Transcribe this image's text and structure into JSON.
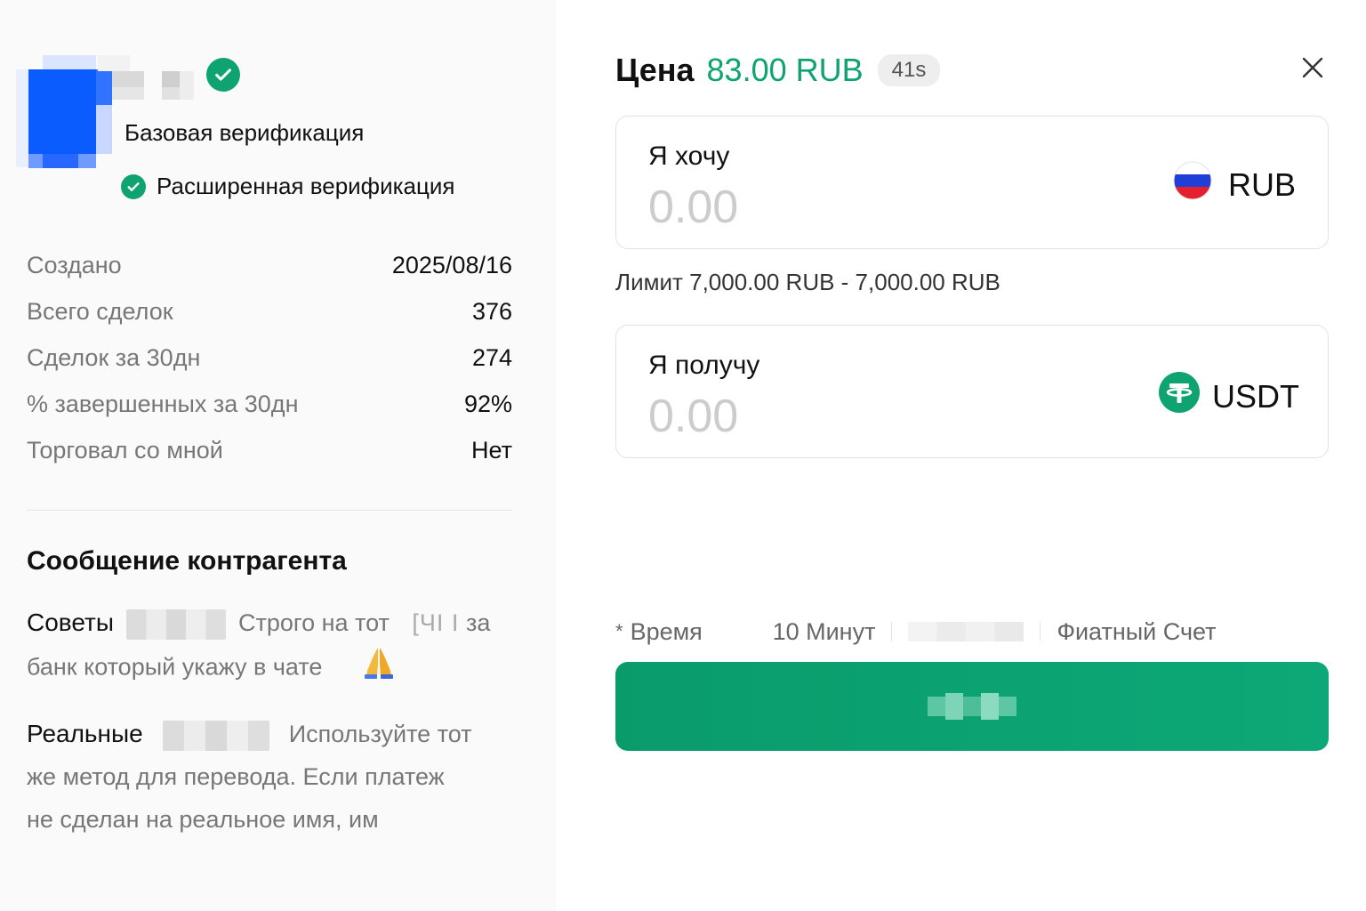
{
  "profile": {
    "verification_basic": "Базовая верификация",
    "verification_advanced": "Расширенная верификация",
    "accent_color": "#0ea371"
  },
  "stats": [
    {
      "label": "Создано",
      "value": "2025/08/16"
    },
    {
      "label": "Всего сделок",
      "value": "376"
    },
    {
      "label": "Сделок за 30дн",
      "value": "274"
    },
    {
      "label": "% завершенных за 30дн",
      "value": "92%"
    },
    {
      "label": "Торговал со мной",
      "value": "Нет"
    }
  ],
  "message": {
    "title": "Сообщение контрагента",
    "tip1_heading": "Советы",
    "tip1_text_a": "Строго на тот",
    "tip1_glyphs": "[ЧI I",
    "tip1_text_b": "за",
    "tip1_text_c": "банк который укажу в чате",
    "tip2_heading": "Реальные",
    "tip2_text_a": "Используйте тот",
    "tip2_text_b": "же метод для перевода. Если платеж",
    "tip2_text_c": "не сделан на реальное имя, им"
  },
  "order": {
    "price_label": "Цена",
    "price_value": "83.00 RUB",
    "timer": "41s",
    "want_label": "Я хочу",
    "want_placeholder": "0.00",
    "want_currency": "RUB",
    "limit_text": "Лимит 7,000.00 RUB - 7,000.00 RUB",
    "get_label": "Я получу",
    "get_placeholder": "0.00",
    "get_currency": "USDT",
    "info_star": "*",
    "info_time_label": "Время",
    "info_time_value": "10 Минут",
    "info_account": "Фиатный Счет",
    "button_color": "#0a9b6b"
  },
  "icons": {
    "close": "close-icon",
    "verified": "check-circle-icon",
    "rub_flag": "russia-flag-icon",
    "usdt": "tether-icon"
  }
}
